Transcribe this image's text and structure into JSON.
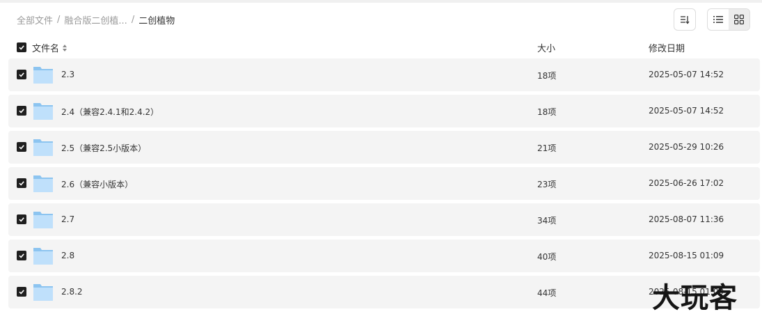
{
  "breadcrumb": [
    {
      "label": "全部文件",
      "current": false
    },
    {
      "label": "融合版二创植...",
      "current": false
    },
    {
      "label": "二创植物",
      "current": true
    }
  ],
  "breadcrumb_separator": "/",
  "toolbar": {
    "sort_icon": "sort-icon",
    "view_list_icon": "list-view-icon",
    "view_grid_icon": "grid-view-icon",
    "active_view": "grid"
  },
  "table": {
    "headers": {
      "name": "文件名",
      "size": "大小",
      "modified": "修改日期"
    },
    "select_all_checked": true,
    "rows": [
      {
        "name": "2.3",
        "size": "18项",
        "modified": "2025-05-07 14:52",
        "checked": true
      },
      {
        "name": "2.4（兼容2.4.1和2.4.2）",
        "size": "18项",
        "modified": "2025-05-07 14:52",
        "checked": true
      },
      {
        "name": "2.5（兼容2.5小版本）",
        "size": "21项",
        "modified": "2025-05-29 10:26",
        "checked": true
      },
      {
        "name": "2.6（兼容小版本）",
        "size": "23项",
        "modified": "2025-06-26 17:02",
        "checked": true
      },
      {
        "name": "2.7",
        "size": "34项",
        "modified": "2025-08-07 11:36",
        "checked": true
      },
      {
        "name": "2.8",
        "size": "40项",
        "modified": "2025-08-15 01:09",
        "checked": true
      },
      {
        "name": "2.8.2",
        "size": "44项",
        "modified": "2025-08-15 01:09",
        "checked": true
      }
    ]
  },
  "watermark": "大玩客",
  "colors": {
    "row_bg": "#f4f4f4",
    "checkbox": "#1f1f1f",
    "folder": "#8cc4f0",
    "folder_light": "#bfe0fb"
  }
}
